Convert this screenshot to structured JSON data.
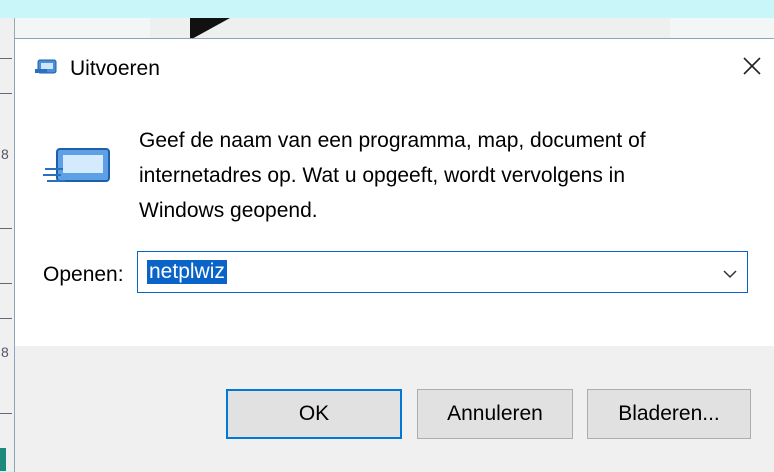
{
  "window": {
    "title": "Uitvoeren",
    "title_icon": "run-icon",
    "close_icon": "close-icon"
  },
  "content": {
    "icon": "run-dialog-icon",
    "description_lines": [
      "Geef de naam van een programma, map, document of",
      "internetadres op. Wat u opgeeft, wordt vervolgens in",
      "Windows geopend."
    ]
  },
  "open": {
    "label": "Openen:",
    "value": "netplwiz",
    "dropdown_icon": "chevron-down-icon"
  },
  "buttons": {
    "ok": "OK",
    "cancel": "Annuleren",
    "browse": "Bladeren..."
  },
  "background": {
    "strip_digits": [
      "8",
      "8"
    ]
  },
  "colors": {
    "accent": "#0a64c8",
    "desktop": "#c9f6f8",
    "footer": "#f0f0f0"
  }
}
